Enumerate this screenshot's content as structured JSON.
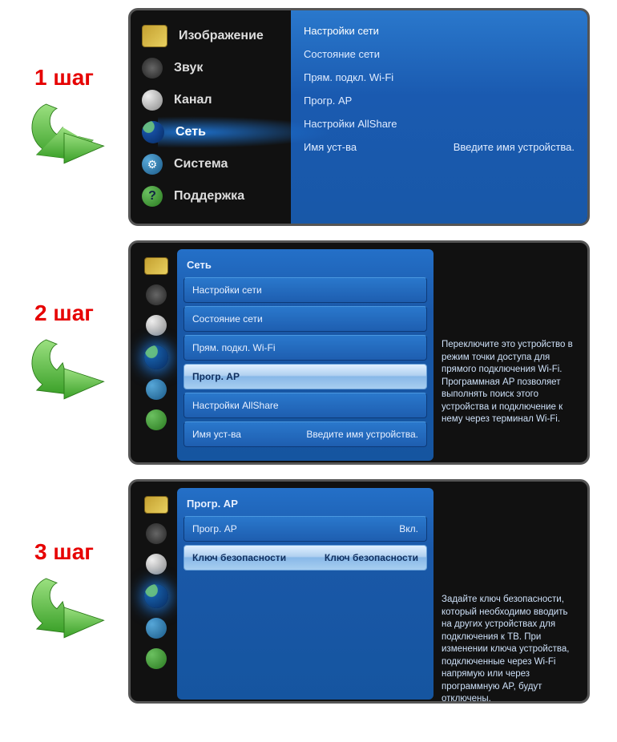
{
  "steps": {
    "s1": {
      "label": "1 шаг"
    },
    "s2": {
      "label": "2 шаг"
    },
    "s3": {
      "label": "3 шаг"
    }
  },
  "step1": {
    "menu": {
      "picture": "Изображение",
      "sound": "Звук",
      "channel": "Канал",
      "network": "Сеть",
      "system": "Система",
      "support": "Поддержка"
    },
    "submenu": {
      "net_settings": "Настройки сети",
      "net_status": "Состояние сети",
      "wifi_direct": "Прям. подкл. Wi-Fi",
      "soft_ap": "Прогр. AP",
      "allshare": "Настройки AllShare",
      "device_name_label": "Имя уст-ва",
      "device_name_value": "Введите имя устройства."
    }
  },
  "step2": {
    "title": "Сеть",
    "rows": {
      "net_settings": "Настройки сети",
      "net_status": "Состояние сети",
      "wifi_direct": "Прям. подкл. Wi-Fi",
      "soft_ap": "Прогр. AP",
      "allshare": "Настройки AllShare",
      "device_name_label": "Имя уст-ва",
      "device_name_value": "Введите имя устройства."
    },
    "info": "Переключите это устройство в режим точки доступа для прямого подключения Wi-Fi. Программная AP позволяет выполнять поиск этого устройства и подключение к нему через терминал Wi-Fi."
  },
  "step3": {
    "title": "Прогр. AP",
    "rows": {
      "soft_ap_label": "Прогр. AP",
      "soft_ap_value": "Вкл.",
      "sec_key_label": "Ключ безопасности",
      "sec_key_value": "Ключ безопасности"
    },
    "info": "Задайте ключ безопасности, который необходимо вводить на других устройствах для подключения к ТВ. При изменении ключа устройства, подключенные через Wi-Fi напрямую или через программную AP, будут отключены."
  }
}
